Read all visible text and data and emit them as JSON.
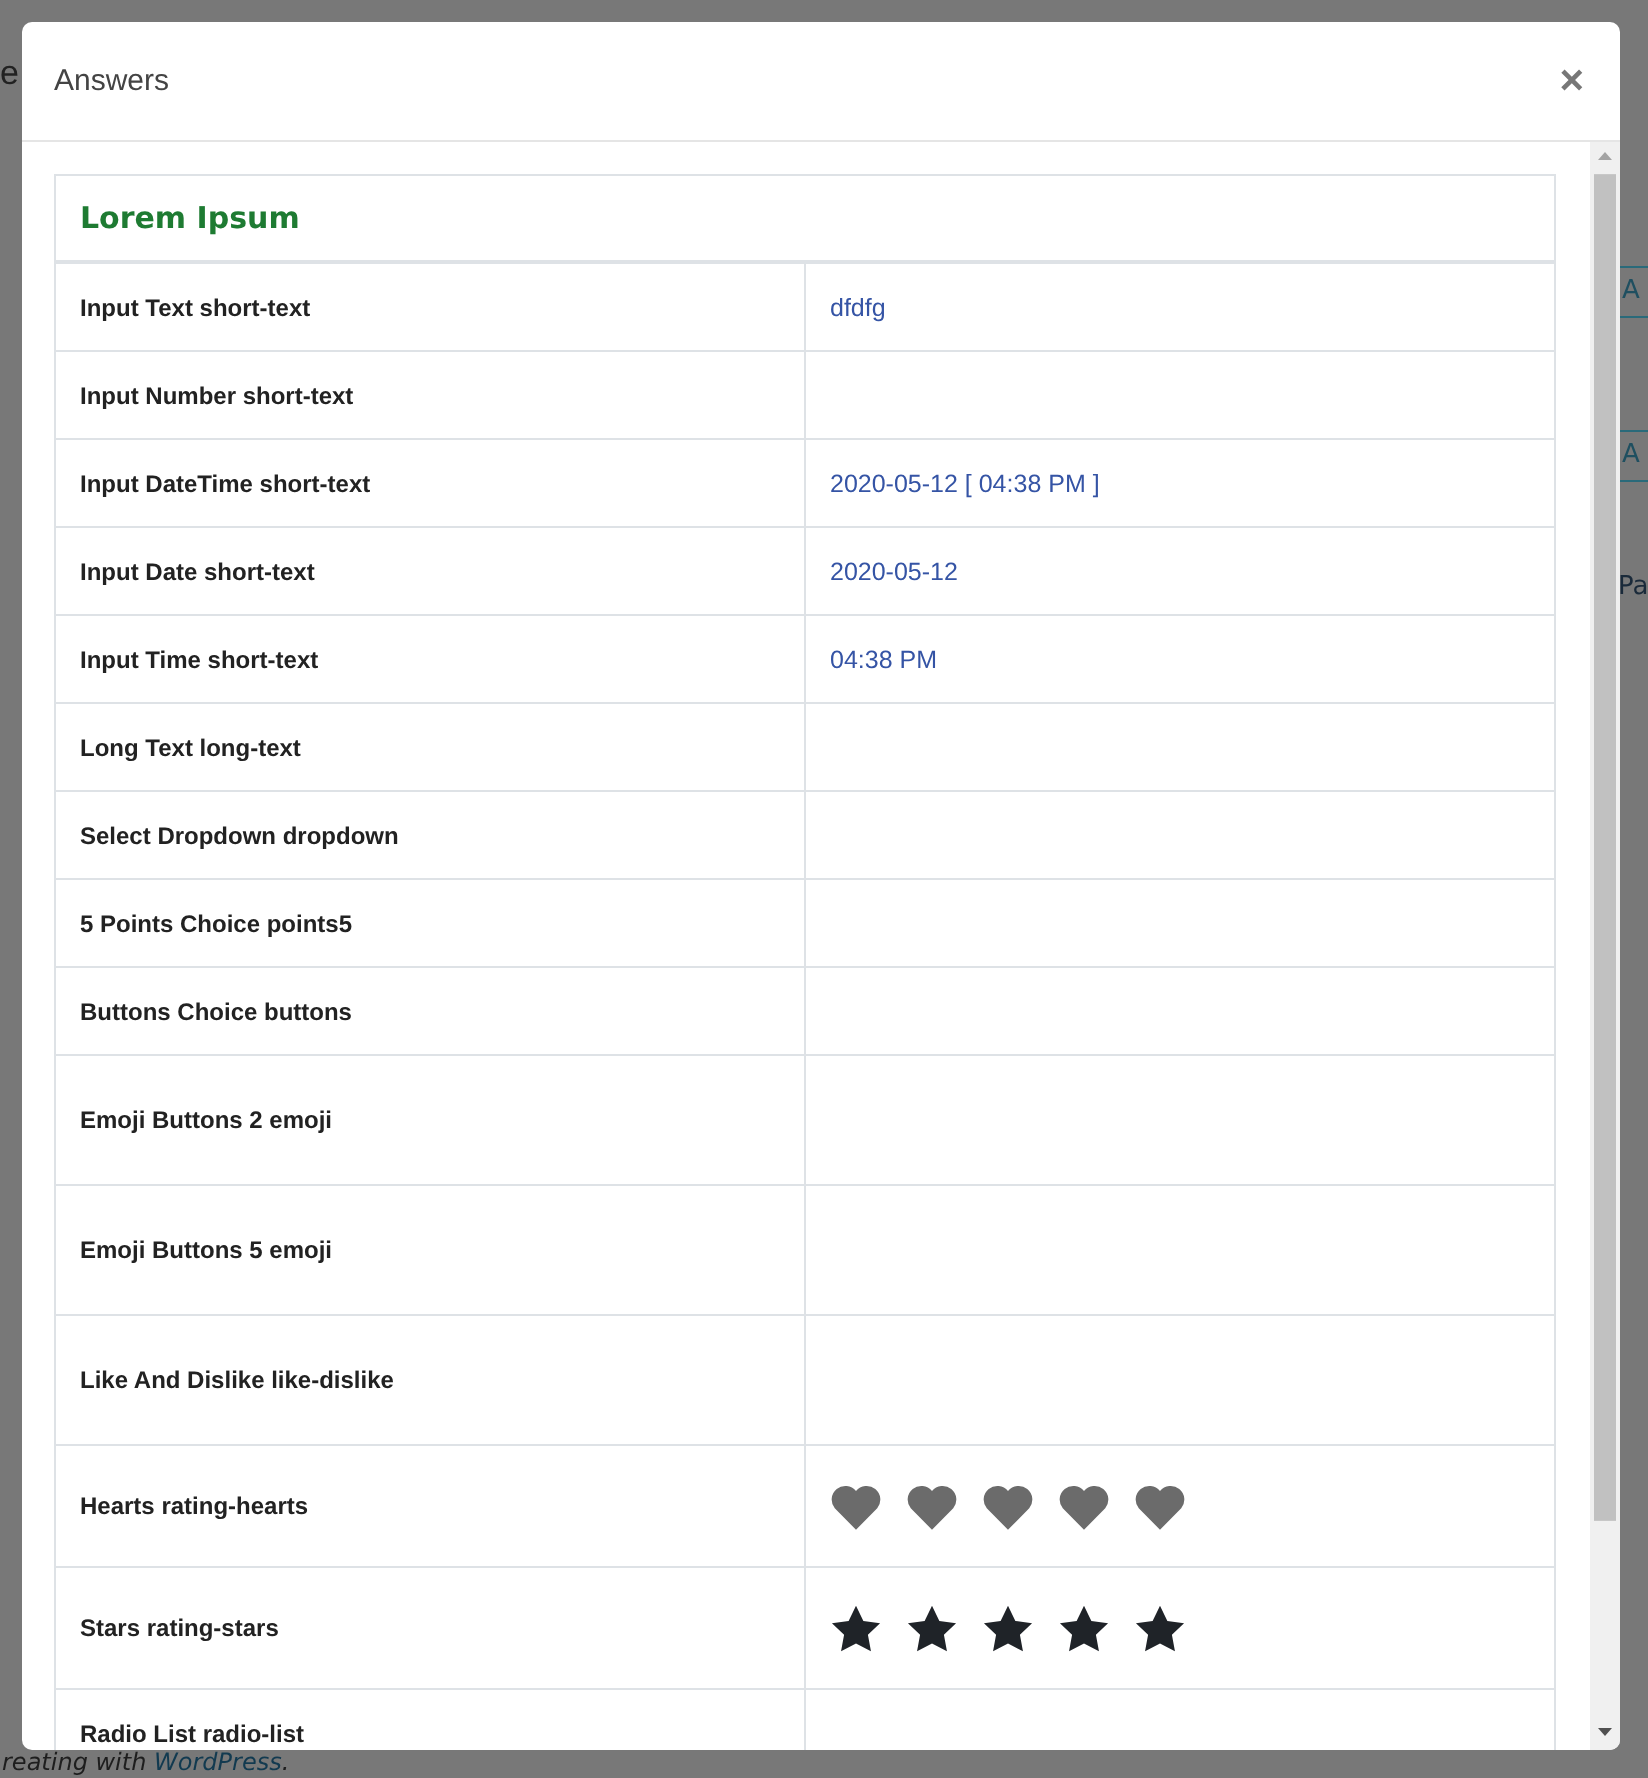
{
  "background": {
    "title": "e",
    "buttons": [
      "A",
      "A"
    ],
    "text": "Pa",
    "footer": {
      "before": "reating with ",
      "link": "WordPress",
      "after": "."
    }
  },
  "modal": {
    "title": "Answers",
    "close": "×"
  },
  "section": {
    "title": "Lorem Ipsum"
  },
  "rows": [
    {
      "kind": "text",
      "label": "Input Text short-text",
      "value": "dfdfg"
    },
    {
      "kind": "text",
      "label": "Input Number short-text"
    },
    {
      "kind": "text",
      "label": "Input DateTime short-text",
      "value": "2020-05-12 [ 04:38 PM ]"
    },
    {
      "kind": "text",
      "label": "Input Date short-text",
      "value": "2020-05-12"
    },
    {
      "kind": "text",
      "label": "Input Time short-text",
      "value": "04:38 PM"
    },
    {
      "kind": "text",
      "label": "Long Text long-text"
    },
    {
      "kind": "text",
      "label": "Select Dropdown dropdown"
    },
    {
      "kind": "text",
      "label": "5 Points Choice points5"
    },
    {
      "kind": "text",
      "label": "Buttons Choice buttons"
    },
    {
      "kind": "tall",
      "label": "Emoji Buttons 2 emoji"
    },
    {
      "kind": "tall",
      "label": "Emoji Buttons 5 emoji"
    },
    {
      "kind": "tall",
      "label": "Like And Dislike like-dislike"
    },
    {
      "kind": "hearts",
      "label": "Hearts rating-hearts",
      "stars": 5
    },
    {
      "kind": "stars",
      "label": "Stars rating-stars",
      "stars": 5
    },
    {
      "kind": "text",
      "label": "Radio List radio-list"
    }
  ]
}
